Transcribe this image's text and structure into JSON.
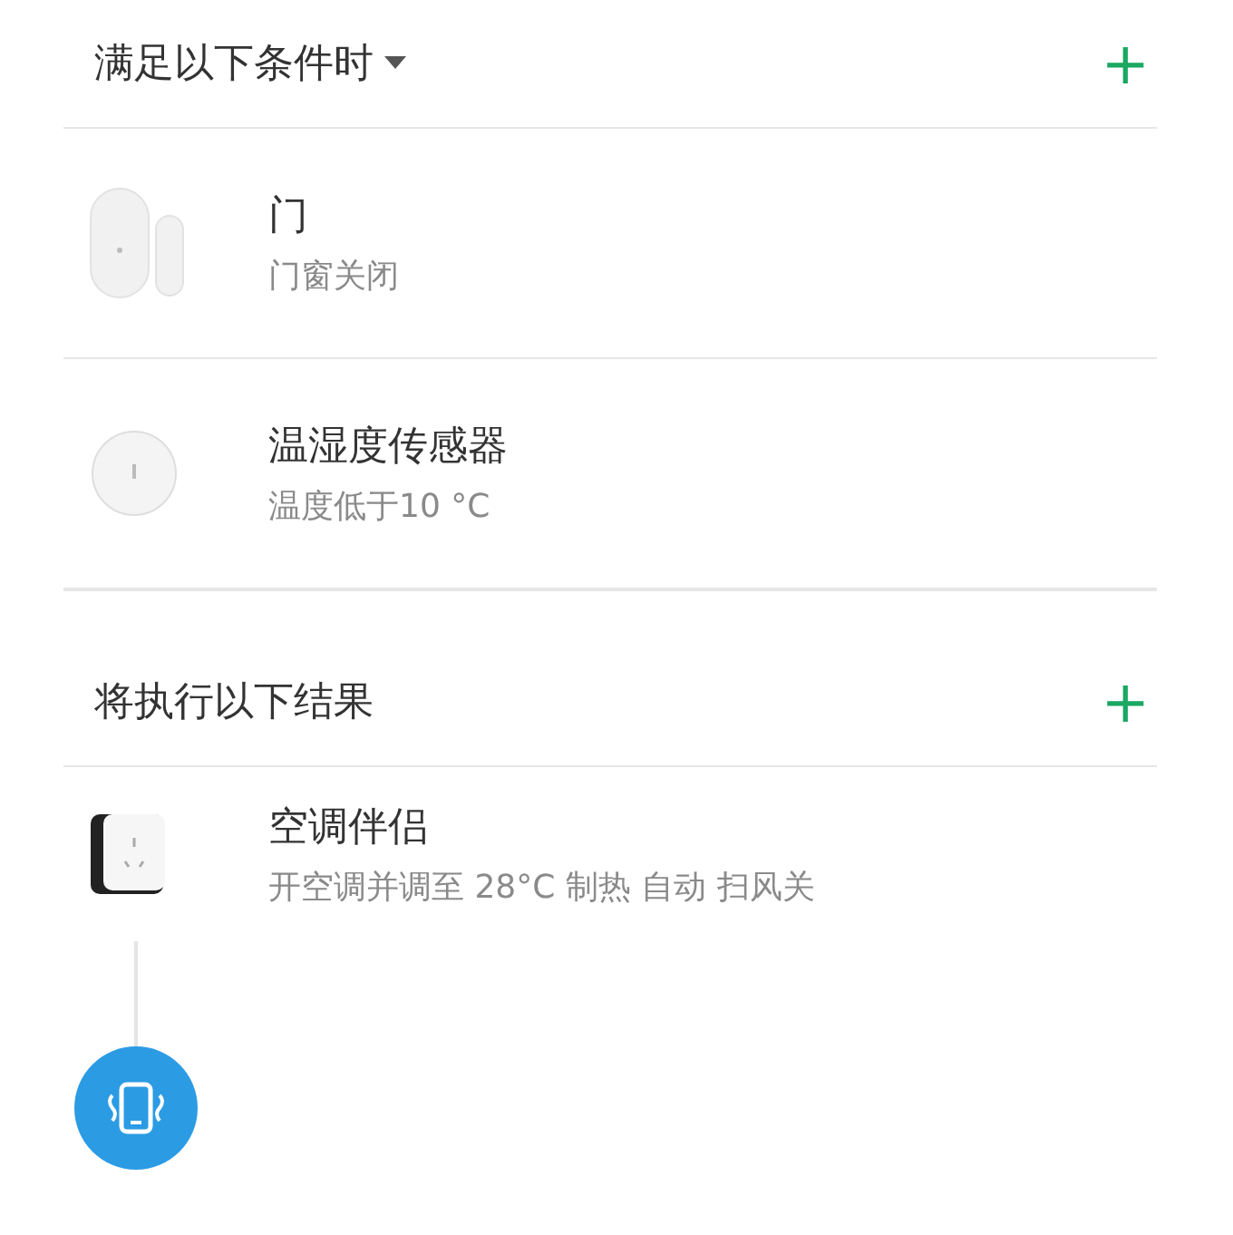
{
  "sections": [
    {
      "title": "满足以下条件时",
      "dropdown": true,
      "add": "+",
      "items": [
        {
          "kind": "door-sensor",
          "name": "门",
          "detail": "门窗关闭"
        },
        {
          "kind": "round-sensor",
          "name": "温湿度传感器",
          "detail": "温度低于10 °C"
        }
      ]
    },
    {
      "title": "将执行以下结果",
      "dropdown": false,
      "add": "+",
      "items": [
        {
          "kind": "plug",
          "name": "空调伴侣",
          "detail": "开空调并调至 28°C 制热 自动 扫风关"
        }
      ],
      "next": {
        "kind": "phone-vibrate"
      }
    }
  ]
}
